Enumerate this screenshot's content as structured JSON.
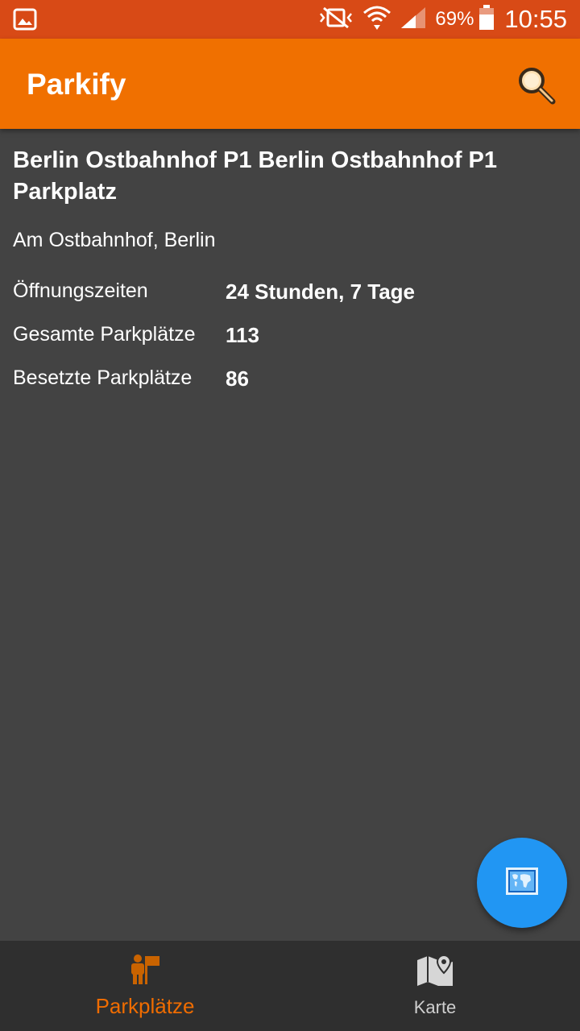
{
  "status_bar": {
    "notification_icon": "image-icon",
    "icons": [
      "vibrate-mute-icon",
      "wifi-icon",
      "signal-icon"
    ],
    "battery_percent": "69%",
    "time": "10:55"
  },
  "app_bar": {
    "title": "Parkify",
    "search_icon": "search-icon"
  },
  "parking_lot": {
    "name": "Berlin Ostbahnhof P1 Berlin Ostbahnhof P1 Parkplatz",
    "address": "Am Ostbahnhof, Berlin",
    "details": [
      {
        "label": "Öffnungszeiten",
        "value": "24 Stunden, 7 Tage"
      },
      {
        "label": "Gesamte Parkplätze",
        "value": "113"
      },
      {
        "label": "Besetzte Parkplätze",
        "value": "86"
      }
    ]
  },
  "fab": {
    "icon": "world-map-icon"
  },
  "bottom_nav": {
    "items": [
      {
        "label": "Parkplätze",
        "icon": "parking-person-icon",
        "active": true
      },
      {
        "label": "Karte",
        "icon": "map-pin-icon",
        "active": false
      }
    ]
  },
  "colors": {
    "status_bar": "#d84a16",
    "app_bar": "#f07000",
    "background": "#434343",
    "fab": "#2196f3",
    "accent": "#ef6c00",
    "bottom_nav": "#2f2f2f"
  }
}
